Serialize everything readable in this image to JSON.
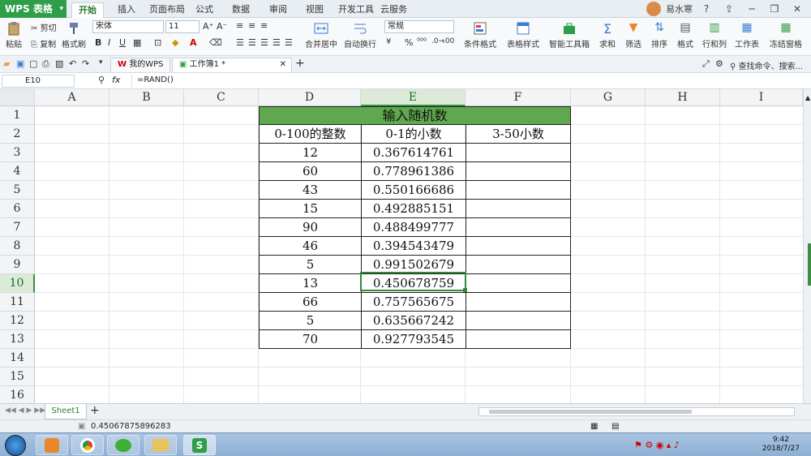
{
  "app": {
    "name": "WPS 表格",
    "user": "易水寒"
  },
  "menu_tabs": [
    "开始",
    "插入",
    "页面布局",
    "公式",
    "数据",
    "审阅",
    "视图",
    "开发工具",
    "云服务"
  ],
  "active_menu_tab": "开始",
  "ribbon": {
    "paste": "粘贴",
    "cut": "剪切",
    "copy": "复制",
    "format_painter": "格式刷",
    "font_name": "宋体",
    "font_size": "11",
    "merge": "合并居中",
    "wrap": "自动换行",
    "number_format": "常规",
    "cond_format": "条件格式",
    "table_style": "表格样式",
    "smart_toolbox": "智能工具箱",
    "sum": "求和",
    "filter": "筛选",
    "sort": "排序",
    "format": "格式",
    "rowcol": "行和列",
    "worksheet": "工作表",
    "freeze": "冻结窗格",
    "search": "查找命令、搜索..."
  },
  "doc_tabs": [
    {
      "label": "我的WPS"
    },
    {
      "label": "工作簿1 *"
    }
  ],
  "name_box": "E10",
  "formula": "=RAND()",
  "columns": [
    "A",
    "B",
    "C",
    "D",
    "E",
    "F",
    "G",
    "H",
    "I"
  ],
  "rows": [
    "1",
    "2",
    "3",
    "4",
    "5",
    "6",
    "7",
    "8",
    "9",
    "10",
    "11",
    "12",
    "13",
    "14",
    "15",
    "16"
  ],
  "table": {
    "title": "输入随机数",
    "headers": [
      "0-100的整数",
      "0-1的小数",
      "3-50小数"
    ],
    "integers": [
      "12",
      "60",
      "43",
      "15",
      "90",
      "46",
      "5",
      "13",
      "66",
      "5",
      "70"
    ],
    "decimals": [
      "0.367614761",
      "0.778961386",
      "0.550166686",
      "0.492885151",
      "0.488499777",
      "0.394543479",
      "0.991502679",
      "0.450678759",
      "0.757565675",
      "0.635667242",
      "0.927793545"
    ]
  },
  "sheet_tab": "Sheet1",
  "status_value": "0.45067875896283",
  "clock": {
    "time": "9:42",
    "date": "2018/7/27"
  },
  "colors": {
    "title_fill": "#5fa84f",
    "selection": "#3a8f45",
    "wps_green": "#2e9e49"
  }
}
